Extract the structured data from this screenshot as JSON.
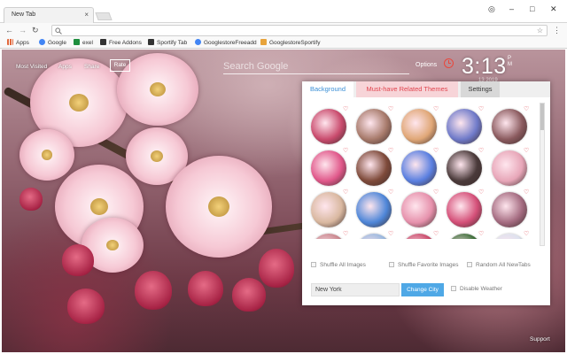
{
  "window": {
    "tab_title": "New Tab",
    "tab_close": "×",
    "controls": {
      "user": "◎",
      "min": "–",
      "max": "□",
      "close": "✕"
    }
  },
  "toolbar": {
    "back": "←",
    "forward": "→",
    "reload": "↻",
    "omnibox_value": "",
    "star": "☆",
    "menu": "⋮"
  },
  "bookmarks": [
    {
      "label": "Apps",
      "icon": "apps-grid-icon",
      "color": "#e2683c"
    },
    {
      "label": "Google",
      "icon": "google-icon",
      "color": "#4285f4"
    },
    {
      "label": "exel",
      "icon": "sheets-icon",
      "color": "#1e8e3e"
    },
    {
      "label": "Free Addons",
      "icon": "addons-icon",
      "color": "#333333"
    },
    {
      "label": "Sportify Tab",
      "icon": "sportify-icon",
      "color": "#333333"
    },
    {
      "label": "GooglestoreFreeadd",
      "icon": "google-icon",
      "color": "#4285f4"
    },
    {
      "label": "GooglestoreSportify",
      "icon": "store-icon",
      "color": "#e8a43c"
    }
  ],
  "topnav": {
    "most_visited": "Most Visited",
    "apps": "Apps",
    "share": "Share",
    "rate": "Rate",
    "search_placeholder": "Search Google",
    "options": "Options",
    "time": "3:13",
    "ampm_top": "P",
    "ampm_bottom": "M",
    "date_hint": "13 2019"
  },
  "panel": {
    "tabs": {
      "background": "Background",
      "must_have": "Must-have Related Themes",
      "settings": "Settings"
    },
    "heart": "♡",
    "thumbnail_colors": [
      [
        "#c94b6d",
        "#a77a6b",
        "#e0a777",
        "#6f7ac9",
        "#8a5a5e"
      ],
      [
        "#e0588a",
        "#7e4a3a",
        "#5a7fe0",
        "#4a3a3a",
        "#e7a6b8"
      ],
      [
        "#d9b8a0",
        "#4e86d8",
        "#e691ac",
        "#d44f78",
        "#a46b80"
      ],
      [
        "#c9878e",
        "#9ab8de",
        "#c94c6c",
        "#3e6e3a",
        "#dde1ee"
      ]
    ],
    "shuffle_all": "Shuffle All Images",
    "shuffle_fav": "Shuffle Favorite Images",
    "random_all": "Random All NewTabs",
    "city_value": "New York",
    "change_city": "Change City",
    "disable_weather": "Disable Weather"
  },
  "footer": {
    "support": "Support"
  }
}
